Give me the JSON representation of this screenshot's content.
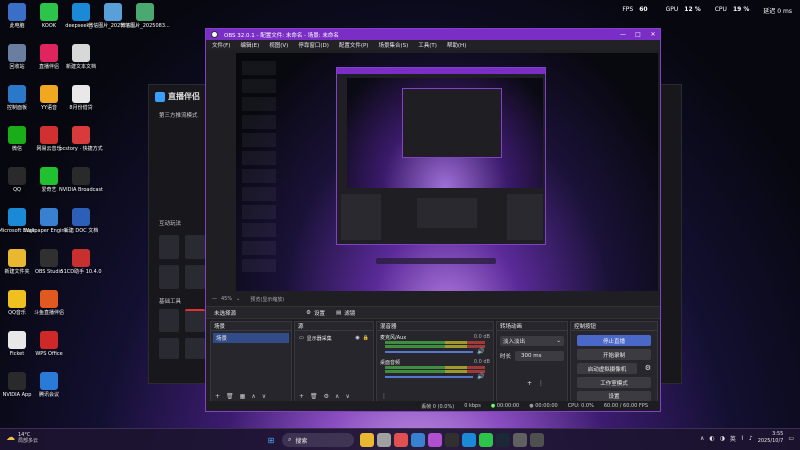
{
  "topbar": {
    "fps_label": "FPS",
    "fps_value": "60",
    "gpu_label": "GPU",
    "gpu_value": "12 %",
    "cpu_label": "CPU",
    "cpu_value": "19 %",
    "latency": "延迟 0 ms"
  },
  "desktop": [
    {
      "label": "此电脑",
      "icon": "computer-icon",
      "color": "#3a6fc8"
    },
    {
      "label": "KOOK",
      "icon": "kook-icon",
      "color": "#2cc44a"
    },
    {
      "label": "deepseek_...",
      "icon": "edge-icon",
      "color": "#1b8ad6"
    },
    {
      "label": "微信图片_2025083...",
      "icon": "image-file-icon",
      "color": "#5aa0d8"
    },
    {
      "label": "微信图片_2025083...",
      "icon": "image-file-icon",
      "color": "#4aa870"
    },
    {
      "label": "回收站",
      "icon": "recycle-bin-icon",
      "color": "#6a7fa0"
    },
    {
      "label": "直播伴侣",
      "icon": "douyin-live-icon",
      "color": "#e0245e"
    },
    {
      "label": "新建文本文档",
      "icon": "text-file-icon",
      "color": "#d8d8d8"
    },
    {
      "label": "控制面板",
      "icon": "control-panel-icon",
      "color": "#2b78c8"
    },
    {
      "label": "YY语音",
      "icon": "yy-icon",
      "color": "#f0a820"
    },
    {
      "label": "8月份借贷",
      "icon": "document-icon",
      "color": "#e8e8e8"
    },
    {
      "label": "微信",
      "icon": "wechat-icon",
      "color": "#1aad19"
    },
    {
      "label": "网易云音乐",
      "icon": "netease-music-icon",
      "color": "#d03030"
    },
    {
      "label": "pcstory · 快捷方式",
      "icon": "pcstory-icon",
      "color": "#d83b3b"
    },
    {
      "label": "QQ",
      "icon": "qq-icon",
      "color": "#2a2a2a"
    },
    {
      "label": "爱奇艺",
      "icon": "iqiyi-icon",
      "color": "#20c030"
    },
    {
      "label": "NVIDIA Broadcast",
      "icon": "nvidia-icon",
      "color": "#2a2a2a"
    },
    {
      "label": "Microsoft Edge",
      "icon": "edge-icon",
      "color": "#1b8ad6"
    },
    {
      "label": "Wallpaper Engine:...",
      "icon": "wallpaper-engine-icon",
      "color": "#3a80d0"
    },
    {
      "label": "新建 DOC 文档",
      "icon": "word-icon",
      "color": "#2b5fb8"
    },
    {
      "label": "新建文件夹",
      "icon": "folder-icon",
      "color": "#e8b830"
    },
    {
      "label": "OBS Studio",
      "icon": "obs-icon",
      "color": "#303030"
    },
    {
      "label": "51CD助手 10.4.0",
      "icon": "assistant-icon",
      "color": "#c83030"
    },
    {
      "label": "QQ音乐",
      "icon": "qq-music-icon",
      "color": "#f0c020"
    },
    {
      "label": "斗鱼直播伴侣",
      "icon": "douyu-icon",
      "color": "#e05a20"
    },
    {
      "label": "Ficket",
      "icon": "ficket-icon",
      "color": "#e8e8e8"
    },
    {
      "label": "WPS Office",
      "icon": "wps-icon",
      "color": "#d02828"
    },
    {
      "label": "NVIDIA App",
      "icon": "nvidia-icon",
      "color": "#2a2a2a"
    },
    {
      "label": "腾讯会议",
      "icon": "tencent-meeting-icon",
      "color": "#2a7ad8"
    }
  ],
  "bg_window": {
    "app": "直播伴侣",
    "mode": "第三方推流模式",
    "section1": "互动玩法",
    "section2": "基础工具"
  },
  "obs": {
    "title": "OBS 32.0.1 - 配置文件: 未命名 - 场景: 未命名",
    "menu": [
      "文件(F)",
      "编辑(E)",
      "视图(V)",
      "停靠窗口(D)",
      "配置文件(P)",
      "场景集合(S)",
      "工具(T)",
      "帮助(H)"
    ],
    "zoom": "45%",
    "preview_label": "预览(显示缩放)",
    "no_source": "未选择源",
    "properties_btn": "设置",
    "filters_btn": "滤镜",
    "scenes": {
      "title": "场景",
      "items": [
        "场景"
      ]
    },
    "sources": {
      "title": "源",
      "items": [
        "显示器采集"
      ]
    },
    "mixer": {
      "title": "混音器",
      "ch1": "麦克风/Aux",
      "ch1_db": "0.0 dB",
      "ch2": "桌面音频",
      "ch2_db": "0.0 dB"
    },
    "transitions": {
      "title": "转场动画",
      "selected": "淡入淡出",
      "duration_label": "时长",
      "duration": "300 ms"
    },
    "controls": {
      "title": "控制按钮",
      "stop_stream": "停止直播",
      "start_rec": "开始录制",
      "virtual_cam": "启动虚拟摄像机",
      "studio_mode": "工作室模式",
      "settings": "设置"
    },
    "status": {
      "dropped": "丢帧 0 (0.0%)",
      "bitrate": "0 kbps",
      "stream_time": "00:00:00",
      "rec_time": "00:00:00",
      "cpu": "CPU: 0.0%",
      "fps": "60.00 / 60.00 FPS"
    }
  },
  "taskbar": {
    "weather_temp": "14°C",
    "weather_desc": "局部多云",
    "search": "搜索",
    "ime": "英",
    "time": "3:55",
    "date": "2025/10/7"
  },
  "colors": {
    "accent": "#7b2ec5",
    "stop_stream": "#4a68c8"
  }
}
